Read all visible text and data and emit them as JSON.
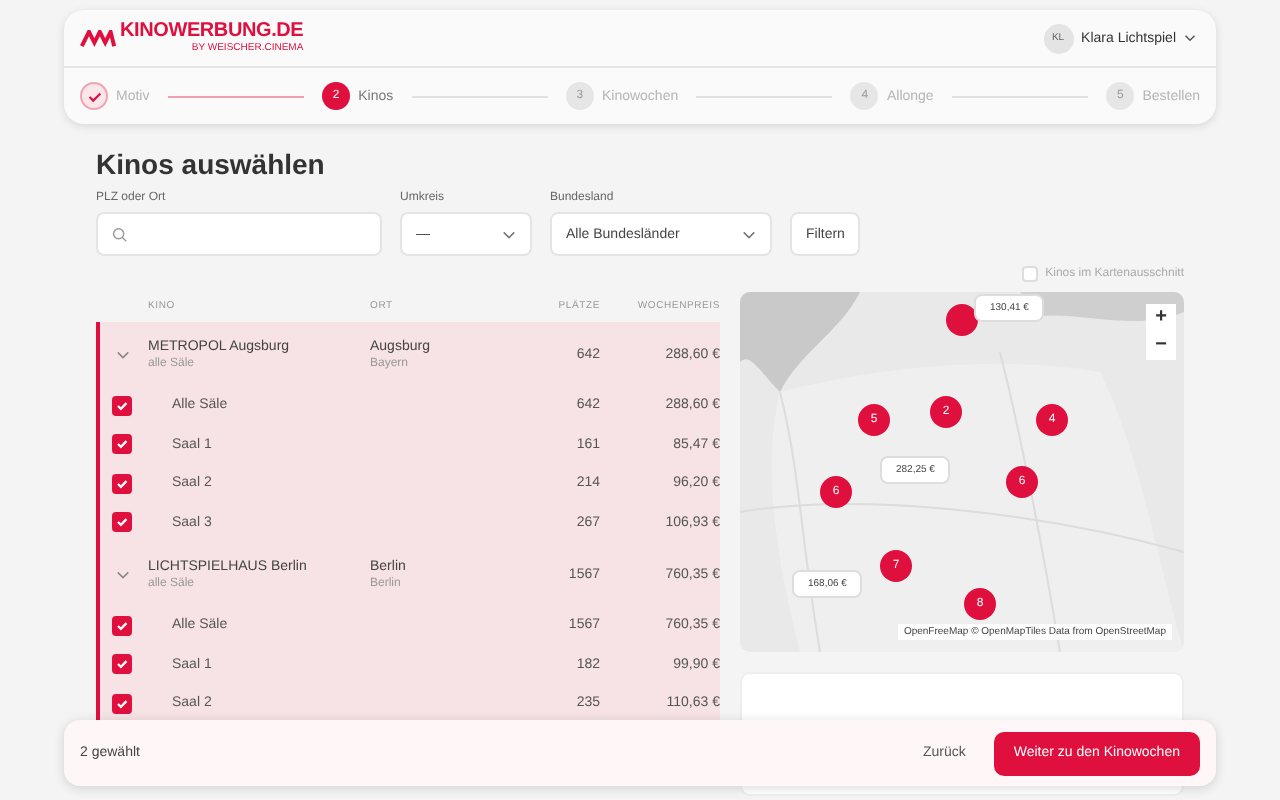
{
  "header": {
    "logo": "KINOWERBUNG.DE",
    "logo_tagline": "BY WEISCHER.CINEMA",
    "user": {
      "initials": "KL",
      "name": "Klara Lichtspiel"
    }
  },
  "steps": [
    {
      "label": "Motiv",
      "done": true,
      "selected": false
    },
    {
      "number": "2",
      "label": "Kinos",
      "done": false,
      "selected": true
    },
    {
      "number": "3",
      "label": "Kinowochen",
      "done": false,
      "selected": false
    },
    {
      "number": "4",
      "label": "Allonge",
      "done": false,
      "selected": false
    },
    {
      "number": "5",
      "label": "Bestellen",
      "done": false,
      "selected": false
    }
  ],
  "title": "Kinos auswählen",
  "filters": {
    "location": {
      "label": "PLZ oder Ort"
    },
    "radius": {
      "label": "Umkreis",
      "value": "—"
    },
    "state": {
      "label": "Bundesland",
      "value": "Alle Bundesländer"
    },
    "button": "Filtern"
  },
  "table": {
    "columns": [
      "KINO",
      "ORT",
      "PLÄTZE",
      "WOCHENPREIS"
    ],
    "groups": [
      {
        "name": "METROPOL Augsburg",
        "subtitle": "alle Säle",
        "city": "Augsburg",
        "region": "Bayern",
        "seats": "642",
        "price": "288,60 €",
        "selected": true,
        "expanded": true,
        "rows": [
          {
            "name": "Alle Säle",
            "seats": "642",
            "price": "288,60 €",
            "checked": true
          },
          {
            "name": "Saal 1",
            "seats": "161",
            "price": "85,47 €",
            "checked": true
          },
          {
            "name": "Saal 2",
            "seats": "214",
            "price": "96,20 €",
            "checked": true
          },
          {
            "name": "Saal 3",
            "seats": "267",
            "price": "106,93 €",
            "checked": true
          }
        ]
      },
      {
        "name": "LICHTSPIELHAUS Berlin",
        "subtitle": "alle Säle",
        "city": "Berlin",
        "region": "Berlin",
        "seats": "1567",
        "price": "760,35 €",
        "selected": true,
        "expanded": true,
        "rows": [
          {
            "name": "Alle Säle",
            "seats": "1567",
            "price": "760,35 €",
            "checked": true
          },
          {
            "name": "Saal 1",
            "seats": "182",
            "price": "99,90 €",
            "checked": true
          },
          {
            "name": "Saal 2",
            "seats": "235",
            "price": "110,63 €",
            "checked": true
          }
        ]
      }
    ]
  },
  "map": {
    "filter_checkbox": {
      "label": "Kinos im Kartenausschnitt",
      "checked": false
    },
    "clusters": [
      {
        "label": "5"
      },
      {
        "label": "2"
      },
      {
        "label": "4"
      },
      {
        "label": "6"
      },
      {
        "label": "6"
      },
      {
        "label": "7"
      },
      {
        "label": "8"
      }
    ],
    "prices": [
      "130,41 €",
      "282,25 €",
      "168,06 €"
    ],
    "zoom_in": "+",
    "zoom_out": "−",
    "attribution": "OpenFreeMap © OpenMapTiles Data from OpenStreetMap"
  },
  "footer": {
    "count": "2 gewählt",
    "back": "Zurück",
    "next": "Weiter zu den Kinowochen"
  }
}
